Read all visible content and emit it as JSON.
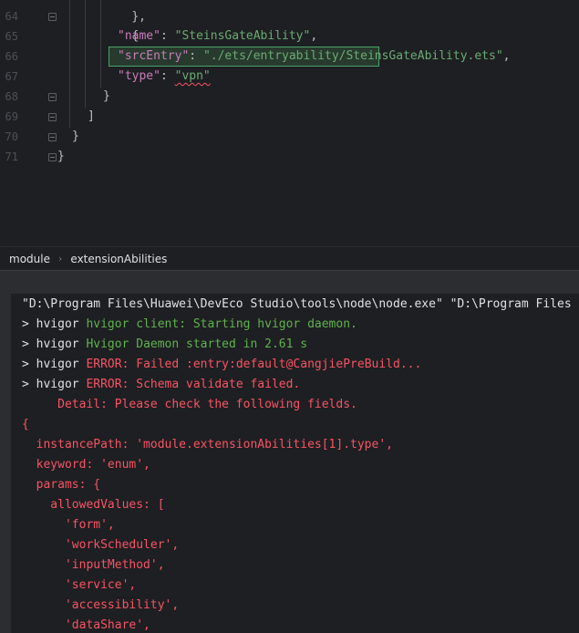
{
  "editor": {
    "lines": [
      {
        "num": "64",
        "top": "{"
      },
      {
        "num": "65",
        "key": "\"name\"",
        "colon": ": ",
        "value": "\"SteinsGateAbility\"",
        "tail": ","
      },
      {
        "num": "66",
        "key": "\"srcEntry\"",
        "colon": ": ",
        "value": "\"./ets/entryability/SteinsGateAbility.ets\"",
        "tail": ","
      },
      {
        "num": "67",
        "key": "\"type\"",
        "colon": ": ",
        "value": "\"vpn\""
      },
      {
        "num": "68",
        "text": "}"
      },
      {
        "num": "69",
        "text": "]"
      },
      {
        "num": "70",
        "text": "}"
      },
      {
        "num": "71",
        "text": "}"
      }
    ],
    "top_partial": "},"
  },
  "breadcrumb": {
    "items": [
      "module",
      "extensionAbilities"
    ],
    "separator": "›"
  },
  "console": {
    "line1": "\"D:\\Program Files\\Huawei\\DevEco Studio\\tools\\node\\node.exe\" \"D:\\Program Files",
    "prefix": "> hvigor ",
    "l2": "hvigor client: Starting hvigor daemon.",
    "l3": "Hvigor Daemon started in 2.61 s",
    "l4": "ERROR: Failed :entry:default@CangjiePreBuild...",
    "l5": "ERROR: Schema validate failed.",
    "l6": "     Detail: Please check the following fields.",
    "l7": "{",
    "l8": "  instancePath: 'module.extensionAbilities[1].type',",
    "l9": "  keyword: 'enum',",
    "l10": "  params: {",
    "l11": "    allowedValues: [",
    "l12": "      'form',",
    "l13": "      'workScheduler',",
    "l14": "      'inputMethod',",
    "l15": "      'service',",
    "l16": "      'accessibility',",
    "l17": "      'dataShare',"
  },
  "colors": {
    "editor_bg": "#1e1f22",
    "json_key": "#c77dbb",
    "string": "#6aab73",
    "error": "#f75464",
    "info_green": "#5fb34e"
  }
}
